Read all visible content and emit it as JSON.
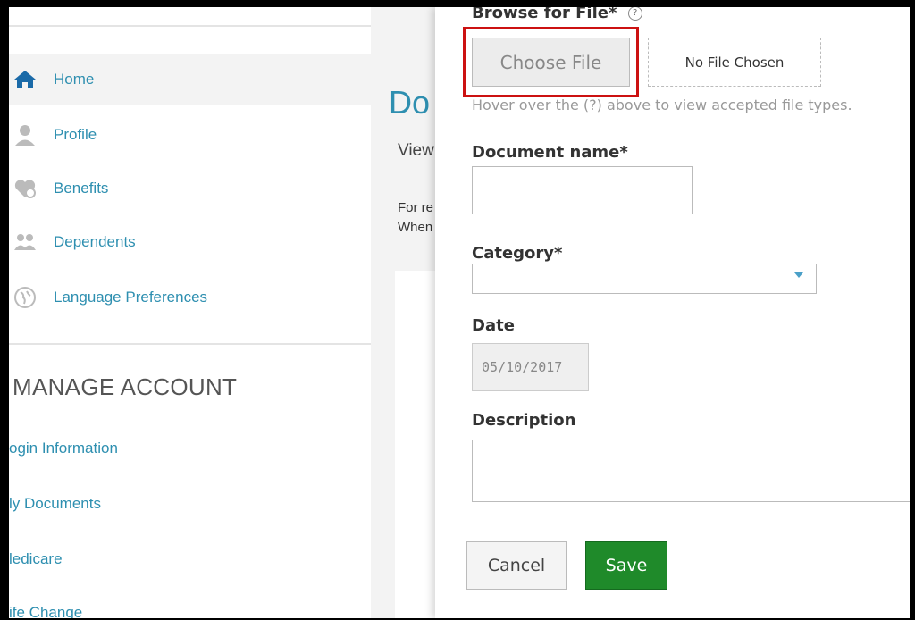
{
  "sidebar": {
    "nav": [
      {
        "label": "Home",
        "icon": "home-icon"
      },
      {
        "label": "Profile",
        "icon": "user-icon"
      },
      {
        "label": "Benefits",
        "icon": "heart-plus-icon"
      },
      {
        "label": "Dependents",
        "icon": "people-icon"
      },
      {
        "label": "Language Preferences",
        "icon": "globe-icon"
      }
    ],
    "manage_title": "MANAGE ACCOUNT",
    "account_links": [
      "ogin Information",
      "ly Documents",
      "ledicare",
      "ife Change"
    ]
  },
  "background": {
    "title": "Do",
    "subtitle": "View",
    "line1": "For re",
    "line2": "When"
  },
  "form": {
    "browse_label": "Browse for File",
    "required_mark": "*",
    "help_glyph": "?",
    "choose_file": "Choose File",
    "no_file": "No File Chosen",
    "hint": "Hover over the (?) above to view accepted file types.",
    "document_name_label": "Document name",
    "category_label": "Category",
    "date_label": "Date",
    "date_value": "05/10/2017",
    "description_label": "Description",
    "cancel": "Cancel",
    "save": "Save"
  },
  "colors": {
    "link": "#2e8fb0",
    "save": "#1f8a2a",
    "highlight": "#cc1111"
  }
}
